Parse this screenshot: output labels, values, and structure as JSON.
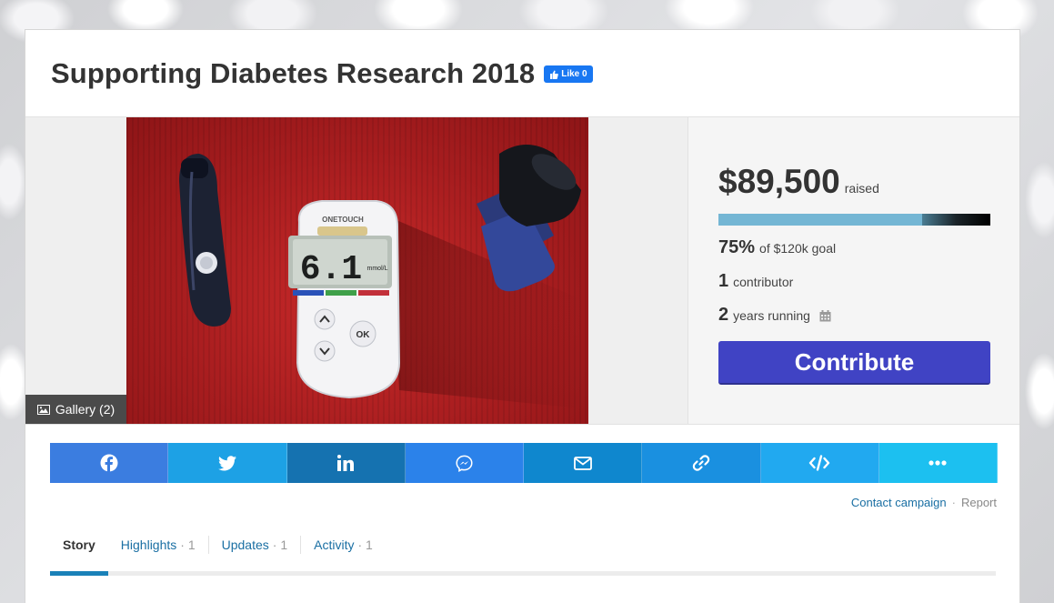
{
  "campaign": {
    "title": "Supporting Diabetes Research 2018",
    "fb_like_label": "Like 0"
  },
  "media": {
    "gallery_label": "Gallery (2)",
    "meter_reading": "6.1",
    "meter_unit": "mmol/L",
    "meter_brand": "ONETOUCH",
    "meter_ok": "OK"
  },
  "stats": {
    "amount": "$89,500",
    "raised_label": "raised",
    "progress_fraction": 0.75,
    "percent": "75%",
    "goal_label": "of $120k goal",
    "contributors_num": "1",
    "contributors_label": "contributor",
    "years_num": "2",
    "years_label": "years running",
    "contribute_label": "Contribute"
  },
  "share": {
    "buttons": [
      {
        "icon": "facebook-icon",
        "color": "#3b7de0"
      },
      {
        "icon": "twitter-icon",
        "color": "#1da1e5"
      },
      {
        "icon": "linkedin-icon",
        "color": "#1572b0"
      },
      {
        "icon": "messenger-icon",
        "color": "#2b82ea"
      },
      {
        "icon": "email-icon",
        "color": "#0f87ce"
      },
      {
        "icon": "link-icon",
        "color": "#1a90e0"
      },
      {
        "icon": "embed-icon",
        "color": "#21a9f0"
      },
      {
        "icon": "more-icon",
        "color": "#1cc0f0"
      }
    ]
  },
  "links": {
    "contact": "Contact campaign",
    "separator": "·",
    "report": "Report"
  },
  "tabs": {
    "story": "Story",
    "highlights": "Highlights",
    "highlights_count": "· 1",
    "updates": "Updates",
    "updates_count": "· 1",
    "activity": "Activity",
    "activity_count": "· 1"
  }
}
